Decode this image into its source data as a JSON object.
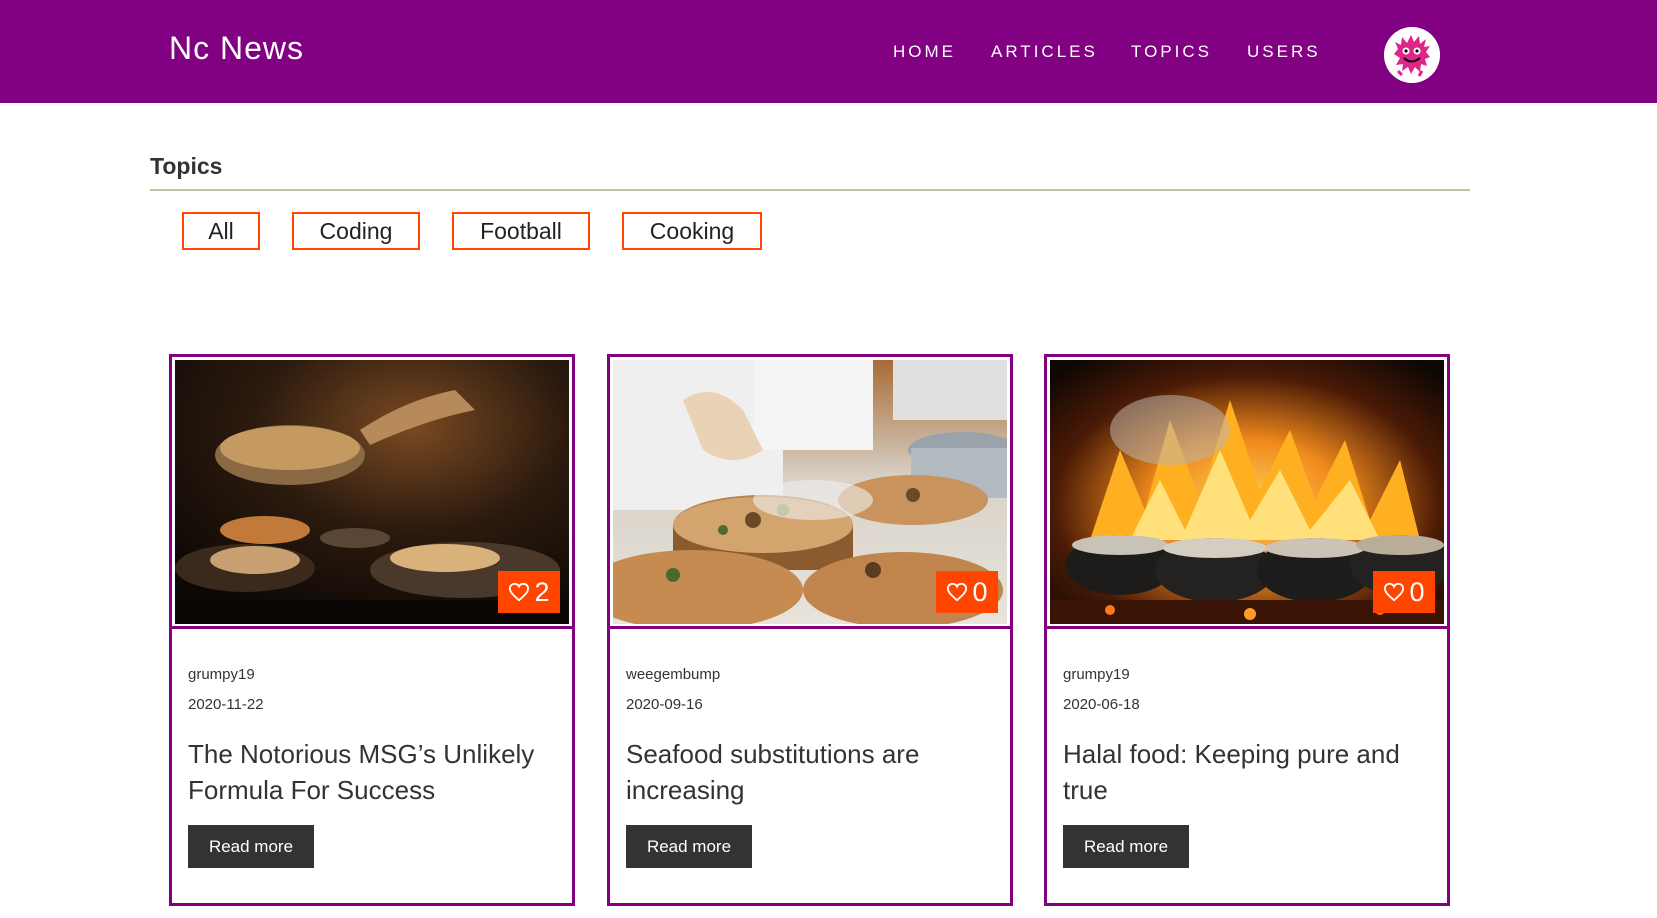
{
  "header": {
    "brand": "Nc News",
    "nav": [
      "HOME",
      "ARTICLES",
      "TOPICS",
      "USERS"
    ],
    "avatar_icon": "pink-fuzzy-monster-avatar"
  },
  "topics": {
    "heading": "Topics",
    "filters": [
      "All",
      "Coding",
      "Football",
      "Cooking"
    ]
  },
  "articles": [
    {
      "author": "grumpy19",
      "date": "2020-11-22",
      "title": "The Notorious MSG’s Unlikely Formula For Success",
      "votes": "2",
      "read_more": "Read more",
      "image": "chef-pouring-sauce-dark-kitchen"
    },
    {
      "author": "weegembump",
      "date": "2020-09-16",
      "title": "Seafood substitutions are increasing",
      "votes": "0",
      "read_more": "Read more",
      "image": "chef-plating-on-wooden-slabs"
    },
    {
      "author": "grumpy19",
      "date": "2020-06-18",
      "title": "Halal food: Keeping pure and true",
      "votes": "0",
      "read_more": "Read more",
      "image": "cauldrons-over-fire"
    }
  ],
  "colors": {
    "header_bg": "#820082",
    "accent": "#ff4500",
    "card_border": "#820082",
    "button_bg": "#333333"
  },
  "icons": {
    "vote": "heart-outline-icon"
  }
}
